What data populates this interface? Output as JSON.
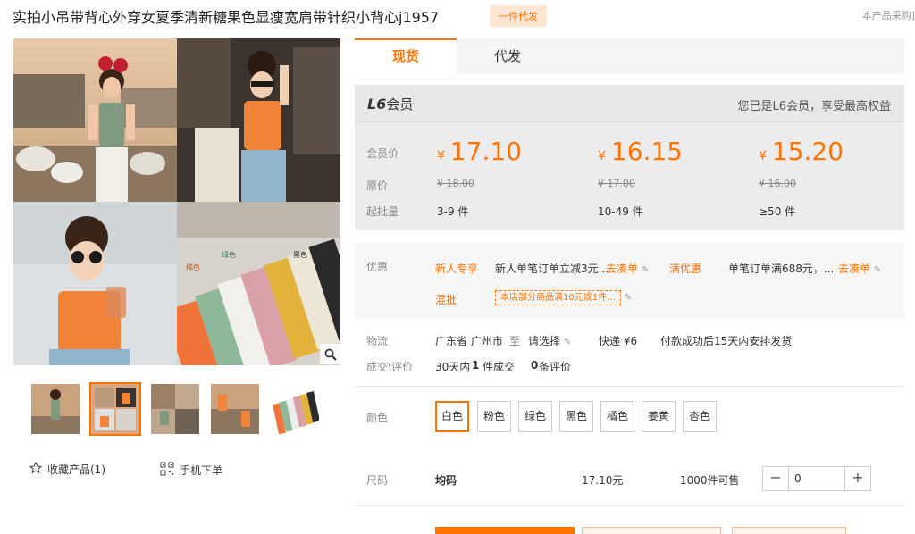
{
  "header": {
    "title": "实拍小吊带背心外穿女夏季清新糖果色显瘦宽肩带针织小背心j1957",
    "badge": "一件代发",
    "note": "本产品采购]"
  },
  "gallery": {
    "image_labels": [
      "橘色",
      "绿色",
      "黑色"
    ],
    "actions": {
      "favorite": "收藏产品(1)",
      "mobile_order": "手机下单"
    }
  },
  "tabs": [
    {
      "label": "现货",
      "active": true
    },
    {
      "label": "代发",
      "active": false
    }
  ],
  "member": {
    "level_prefix": "L6",
    "level_suffix": "会员",
    "note": "您已是L6会员，享受最高权益"
  },
  "price_labels": {
    "member_price": "会员价",
    "orig_price": "原价",
    "moq": "起批量"
  },
  "price_tiers": [
    {
      "currency": "¥",
      "price": "17.10",
      "orig": "¥ 18.00",
      "moq": "3-9 件"
    },
    {
      "currency": "¥",
      "price": "16.15",
      "orig": "¥ 17.00",
      "moq": "10-49 件"
    },
    {
      "currency": "¥",
      "price": "15.20",
      "orig": "¥ 16.00",
      "moq": "≥50 件"
    }
  ],
  "promo": {
    "label": "优惠",
    "new_user_tag": "新人专享",
    "new_user_text": "新人单笔订单立减3元...",
    "go_order_1": "去凑单",
    "full_tag": "满优惠",
    "full_text": "单笔订单满688元，...",
    "go_order_2": "去凑单",
    "mix_tag": "混批",
    "mix_text": "本店部分商品满10元或1件..."
  },
  "logistics": {
    "label": "物流",
    "from": "广东省 广州市",
    "to_word": "至",
    "select": "请选择",
    "express": "快递 ¥6",
    "ship_note": "付款成功后15天内安排发货"
  },
  "deals": {
    "label": "成交\\评价",
    "prefix": "30天内",
    "count": "1",
    "count_suffix": "件成交",
    "reviews": "0",
    "reviews_suffix": "条评价"
  },
  "colors": {
    "label": "颜色",
    "options": [
      "白色",
      "粉色",
      "绿色",
      "黑色",
      "橘色",
      "姜黄",
      "杏色"
    ],
    "selected_index": 0
  },
  "size": {
    "label": "尺码",
    "value": "均码",
    "price": "17.10元",
    "stock": "1000件可售",
    "qty": "0",
    "minus": "−",
    "plus": "+"
  },
  "theme": {
    "accent": "#ff7300"
  }
}
